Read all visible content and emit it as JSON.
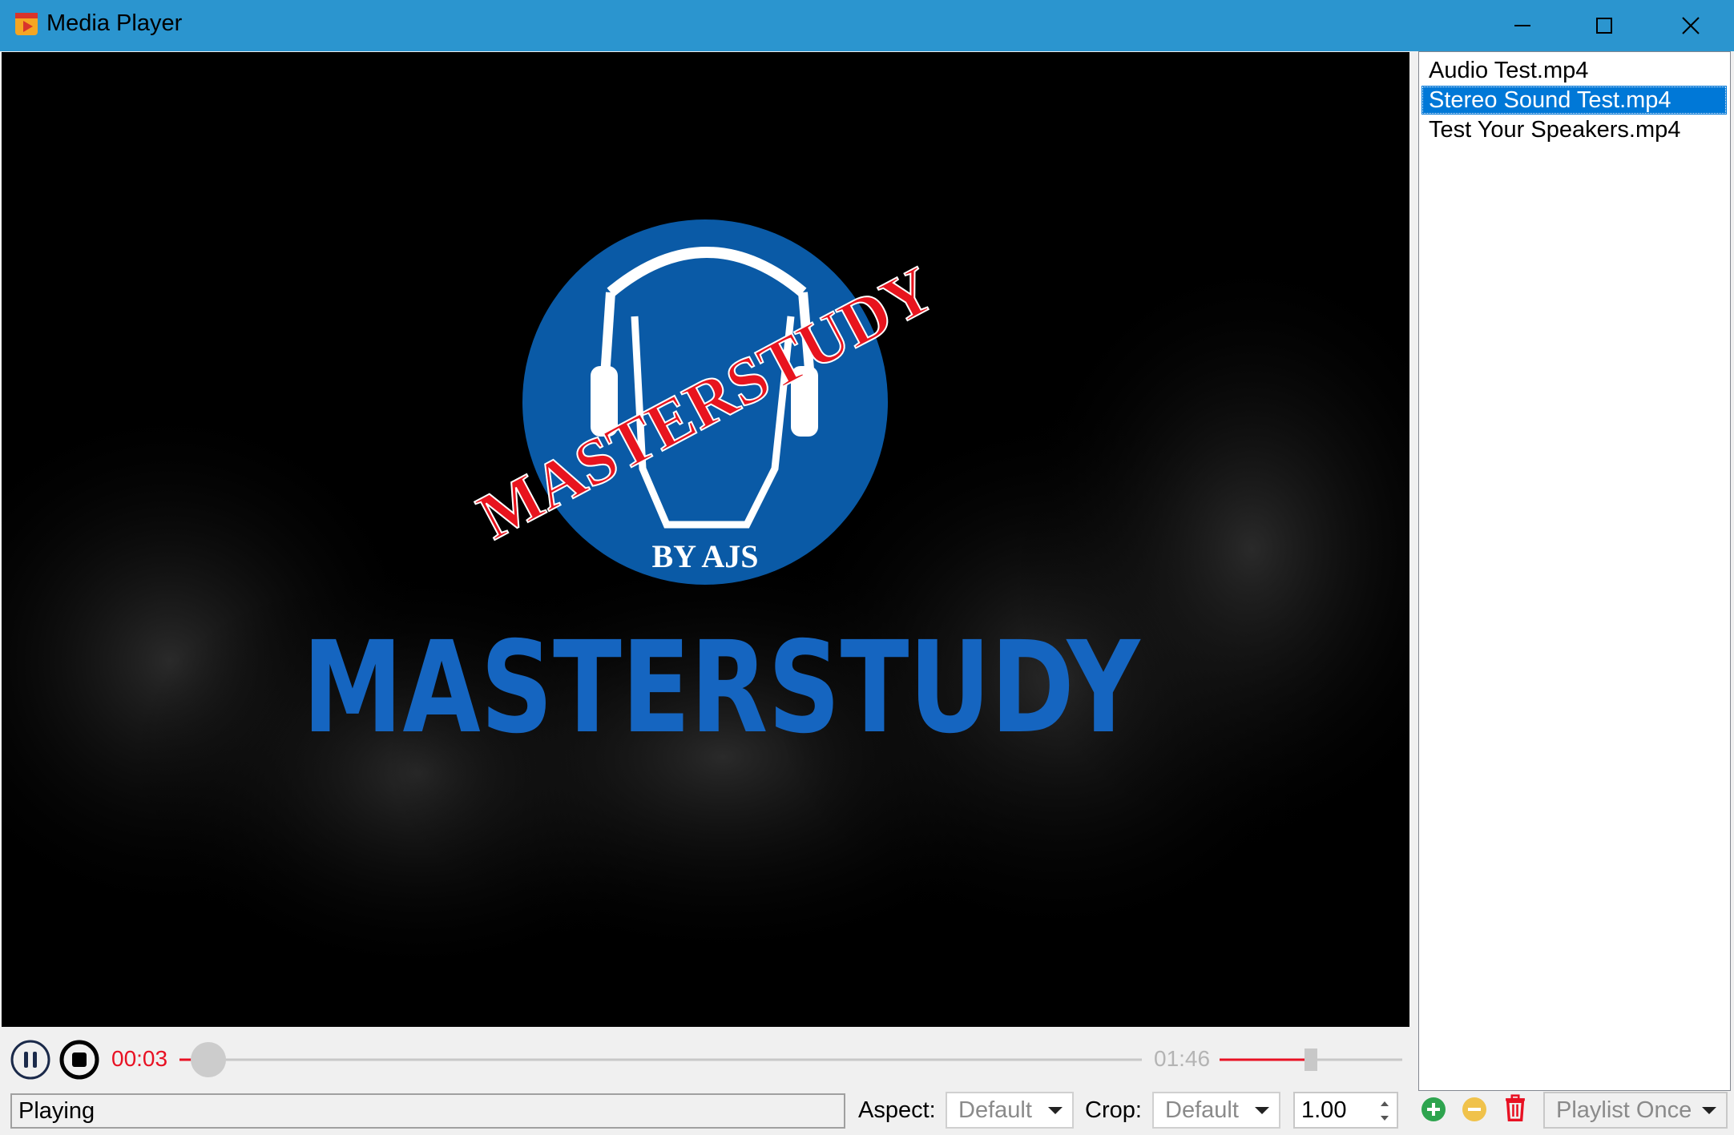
{
  "window": {
    "title": "Media Player",
    "minimize_icon": "minimize-icon",
    "maximize_icon": "maximize-icon",
    "close_icon": "close-icon"
  },
  "video": {
    "logo_arc_text": "MASTERSTUDY",
    "logo_byline": "BY AJS",
    "banner_text": "MASTERSTUDY",
    "colors": {
      "logo_blue": "#0a5aa6",
      "banner_blue": "#1565c0",
      "stamp_red": "#e8141e"
    }
  },
  "playlist": {
    "items": [
      {
        "label": "Audio Test.mp4",
        "selected": false
      },
      {
        "label": "Stereo Sound Test.mp4",
        "selected": true
      },
      {
        "label": "Test Your Speakers.mp4",
        "selected": false
      }
    ]
  },
  "controls": {
    "pause_icon": "pause-icon",
    "stop_icon": "stop-icon",
    "current_time": "00:03",
    "total_time": "01:46",
    "progress_fraction": 0.03,
    "volume_fraction": 0.5,
    "accent_color": "#e81123"
  },
  "statusbar": {
    "status": "Playing",
    "aspect_label": "Aspect:",
    "aspect_value": "Default",
    "crop_label": "Crop:",
    "crop_value": "Default",
    "speed_value": "1.00",
    "add_icon": "add-icon",
    "remove_icon": "remove-icon",
    "delete_icon": "trash-icon",
    "playlist_mode": "Playlist Once"
  }
}
